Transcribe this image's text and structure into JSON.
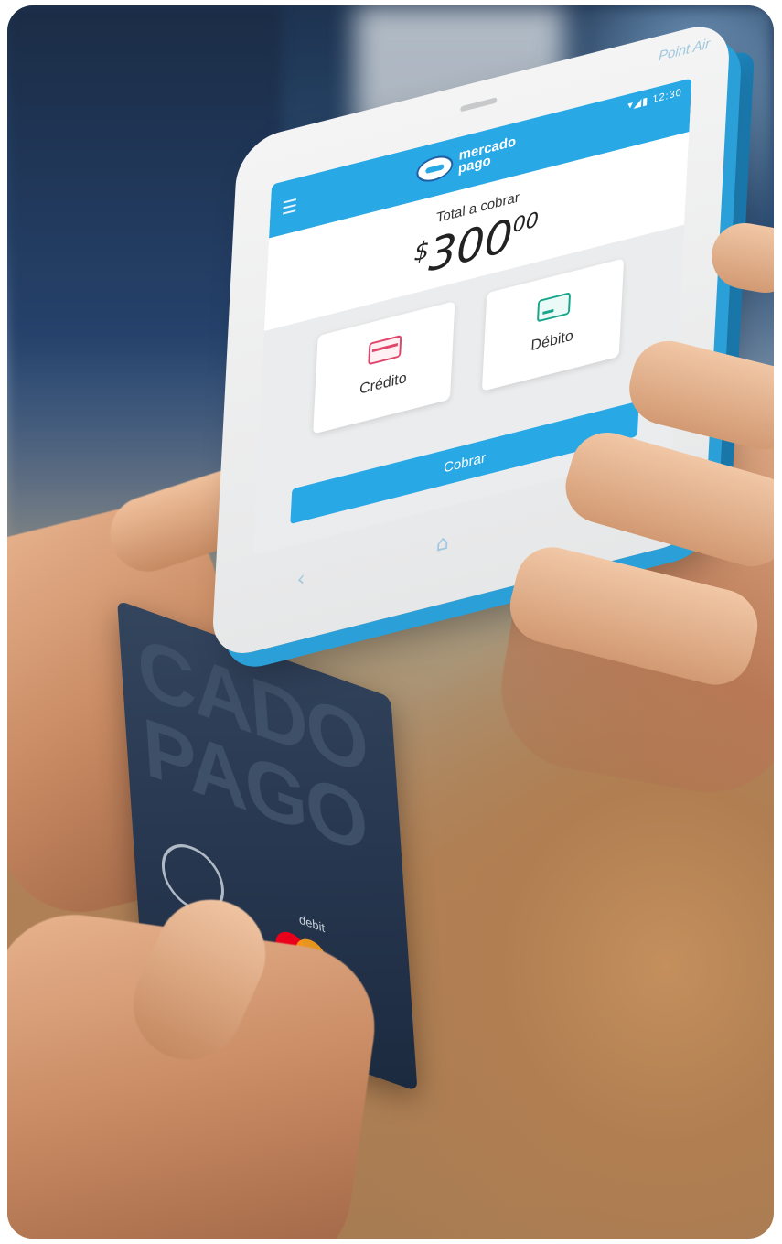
{
  "device": {
    "brand": "Point Air",
    "status_bar": "▾◢▮ 12:30"
  },
  "app": {
    "logo_line1": "mercado",
    "logo_line2": "pago",
    "total_label": "Total a cobrar",
    "amount_currency": "$",
    "amount_value": "300",
    "amount_cents": "00",
    "options": {
      "credit_label": "Crédito",
      "debit_label": "Débito"
    },
    "charge_button": "Cobrar"
  },
  "nav": {
    "back_glyph": "‹",
    "home_glyph": "⌂",
    "apps_glyph": "▦"
  },
  "card": {
    "wordmark_line1": "CADO",
    "wordmark_line2": "PAGO",
    "type_label": "debit"
  },
  "colors": {
    "accent_blue": "#29a8e6",
    "credit_pink": "#e0456a",
    "debit_green": "#18a58c"
  }
}
